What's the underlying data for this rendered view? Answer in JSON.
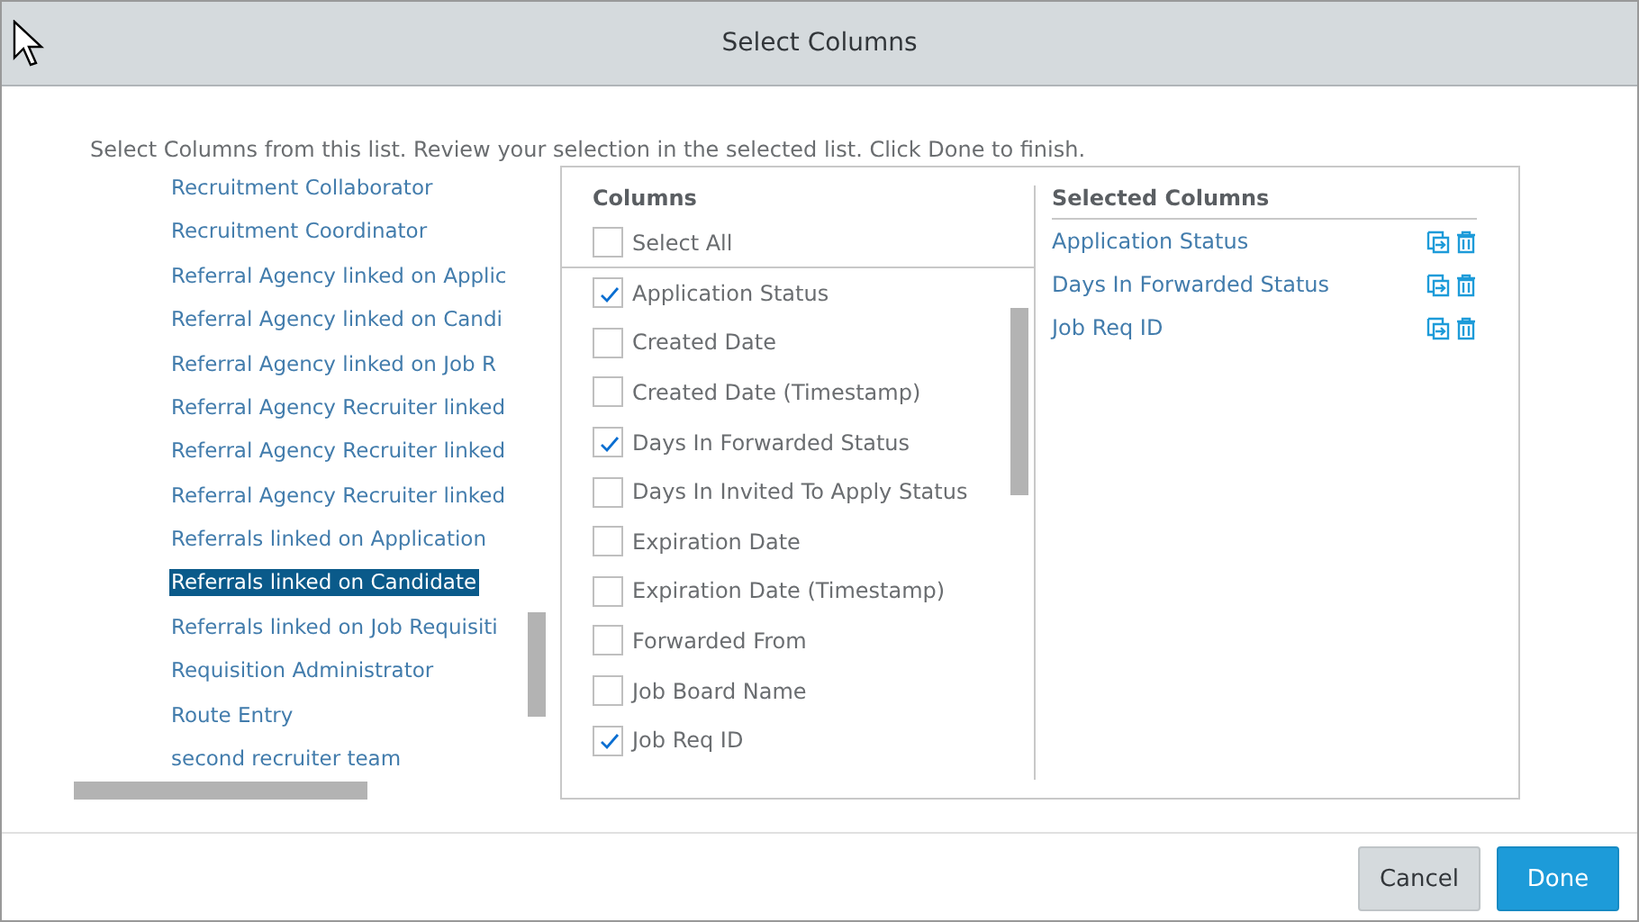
{
  "dialog": {
    "title": "Select Columns",
    "instruction": "Select Columns from this list. Review your selection in the selected list. Click Done to finish."
  },
  "field_list": [
    {
      "label": "Recruitment Collaborator",
      "selected": false
    },
    {
      "label": "Recruitment Coordinator",
      "selected": false
    },
    {
      "label": "Referral Agency linked on Applic",
      "selected": false
    },
    {
      "label": "Referral Agency linked on Candi",
      "selected": false
    },
    {
      "label": "Referral Agency linked on Job R",
      "selected": false
    },
    {
      "label": "Referral Agency Recruiter linked",
      "selected": false
    },
    {
      "label": "Referral Agency Recruiter linked",
      "selected": false
    },
    {
      "label": "Referral Agency Recruiter linked",
      "selected": false
    },
    {
      "label": "Referrals linked on Application",
      "selected": false
    },
    {
      "label": "Referrals linked on Candidate",
      "selected": true
    },
    {
      "label": "Referrals linked on Job Requisiti",
      "selected": false
    },
    {
      "label": "Requisition Administrator",
      "selected": false
    },
    {
      "label": "Route Entry",
      "selected": false
    },
    {
      "label": "second recruiter team",
      "selected": false
    }
  ],
  "columns": {
    "heading": "Columns",
    "select_all": {
      "label": "Select All",
      "checked": false
    },
    "items": [
      {
        "label": "Application Status",
        "checked": true
      },
      {
        "label": "Created Date",
        "checked": false
      },
      {
        "label": "Created Date (Timestamp)",
        "checked": false
      },
      {
        "label": "Days In Forwarded Status",
        "checked": true
      },
      {
        "label": "Days In Invited To Apply Status",
        "checked": false
      },
      {
        "label": "Expiration Date",
        "checked": false
      },
      {
        "label": "Expiration Date (Timestamp)",
        "checked": false
      },
      {
        "label": "Forwarded From",
        "checked": false
      },
      {
        "label": "Job Board Name",
        "checked": false
      },
      {
        "label": "Job Req ID",
        "checked": true
      }
    ]
  },
  "selected_columns": {
    "heading": "Selected Columns",
    "items": [
      "Application Status",
      "Days In Forwarded Status",
      "Job Req ID"
    ]
  },
  "buttons": [
    {
      "label": "Cancel",
      "kind": "secondary"
    },
    {
      "label": "Done",
      "kind": "primary"
    }
  ]
}
